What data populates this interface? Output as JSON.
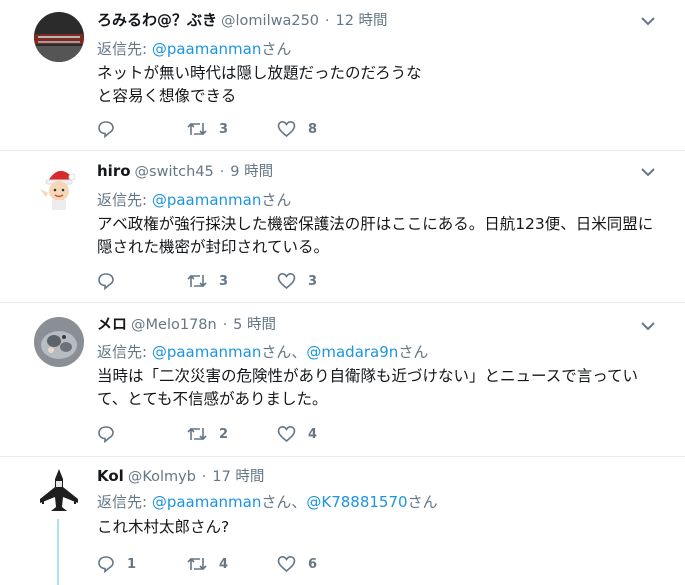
{
  "colors": {
    "link": "#1b95e0",
    "muted": "#657786",
    "text": "#14171a",
    "divider": "#e6ecf0"
  },
  "tweets": [
    {
      "name": "ろみるわ@？ぶき",
      "handle": "@lomilwa250",
      "dot": "·",
      "time": "12 時間",
      "reply_prefix": "返信先: ",
      "mention1": "@paamanman",
      "suffix1": "さん",
      "lines": [
        "ネットが無い時代は隠し放題だったのだろうな",
        "と容易く想像できる"
      ],
      "reply_count": "",
      "retweet_count": "3",
      "like_count": "8"
    },
    {
      "name": "hiro",
      "handle": "@switch45",
      "dot": "·",
      "time": "9 時間",
      "reply_prefix": "返信先: ",
      "mention1": "@paamanman",
      "suffix1": "さん",
      "lines": [
        "アベ政権が強行採決した機密保護法の肝はここにある。日航123便、日米同盟に",
        "隠された機密が封印されている。"
      ],
      "reply_count": "",
      "retweet_count": "3",
      "like_count": "3"
    },
    {
      "name": "メロ",
      "handle": "@Melo178n",
      "dot": "·",
      "time": "5 時間",
      "reply_prefix": "返信先: ",
      "mention1": "@paamanman",
      "suffix1": "さん、",
      "mention2": "@madara9n",
      "suffix2": "さん",
      "lines": [
        "当時は「二次災害の危険性があり自衛隊も近づけない」とニュースで言ってい",
        "て、とても不信感がありました。"
      ],
      "reply_count": "",
      "retweet_count": "2",
      "like_count": "4"
    },
    {
      "name": "Kol",
      "handle": "@Kolmyb",
      "dot": "·",
      "time": "17 時間",
      "reply_prefix": "返信先: ",
      "mention1": "@paamanman",
      "suffix1": "さん、",
      "mention2": "@K78881570",
      "suffix2": "さん",
      "lines": [
        "これ木村太郎さん?"
      ],
      "reply_count": "1",
      "retweet_count": "4",
      "like_count": "6"
    }
  ]
}
